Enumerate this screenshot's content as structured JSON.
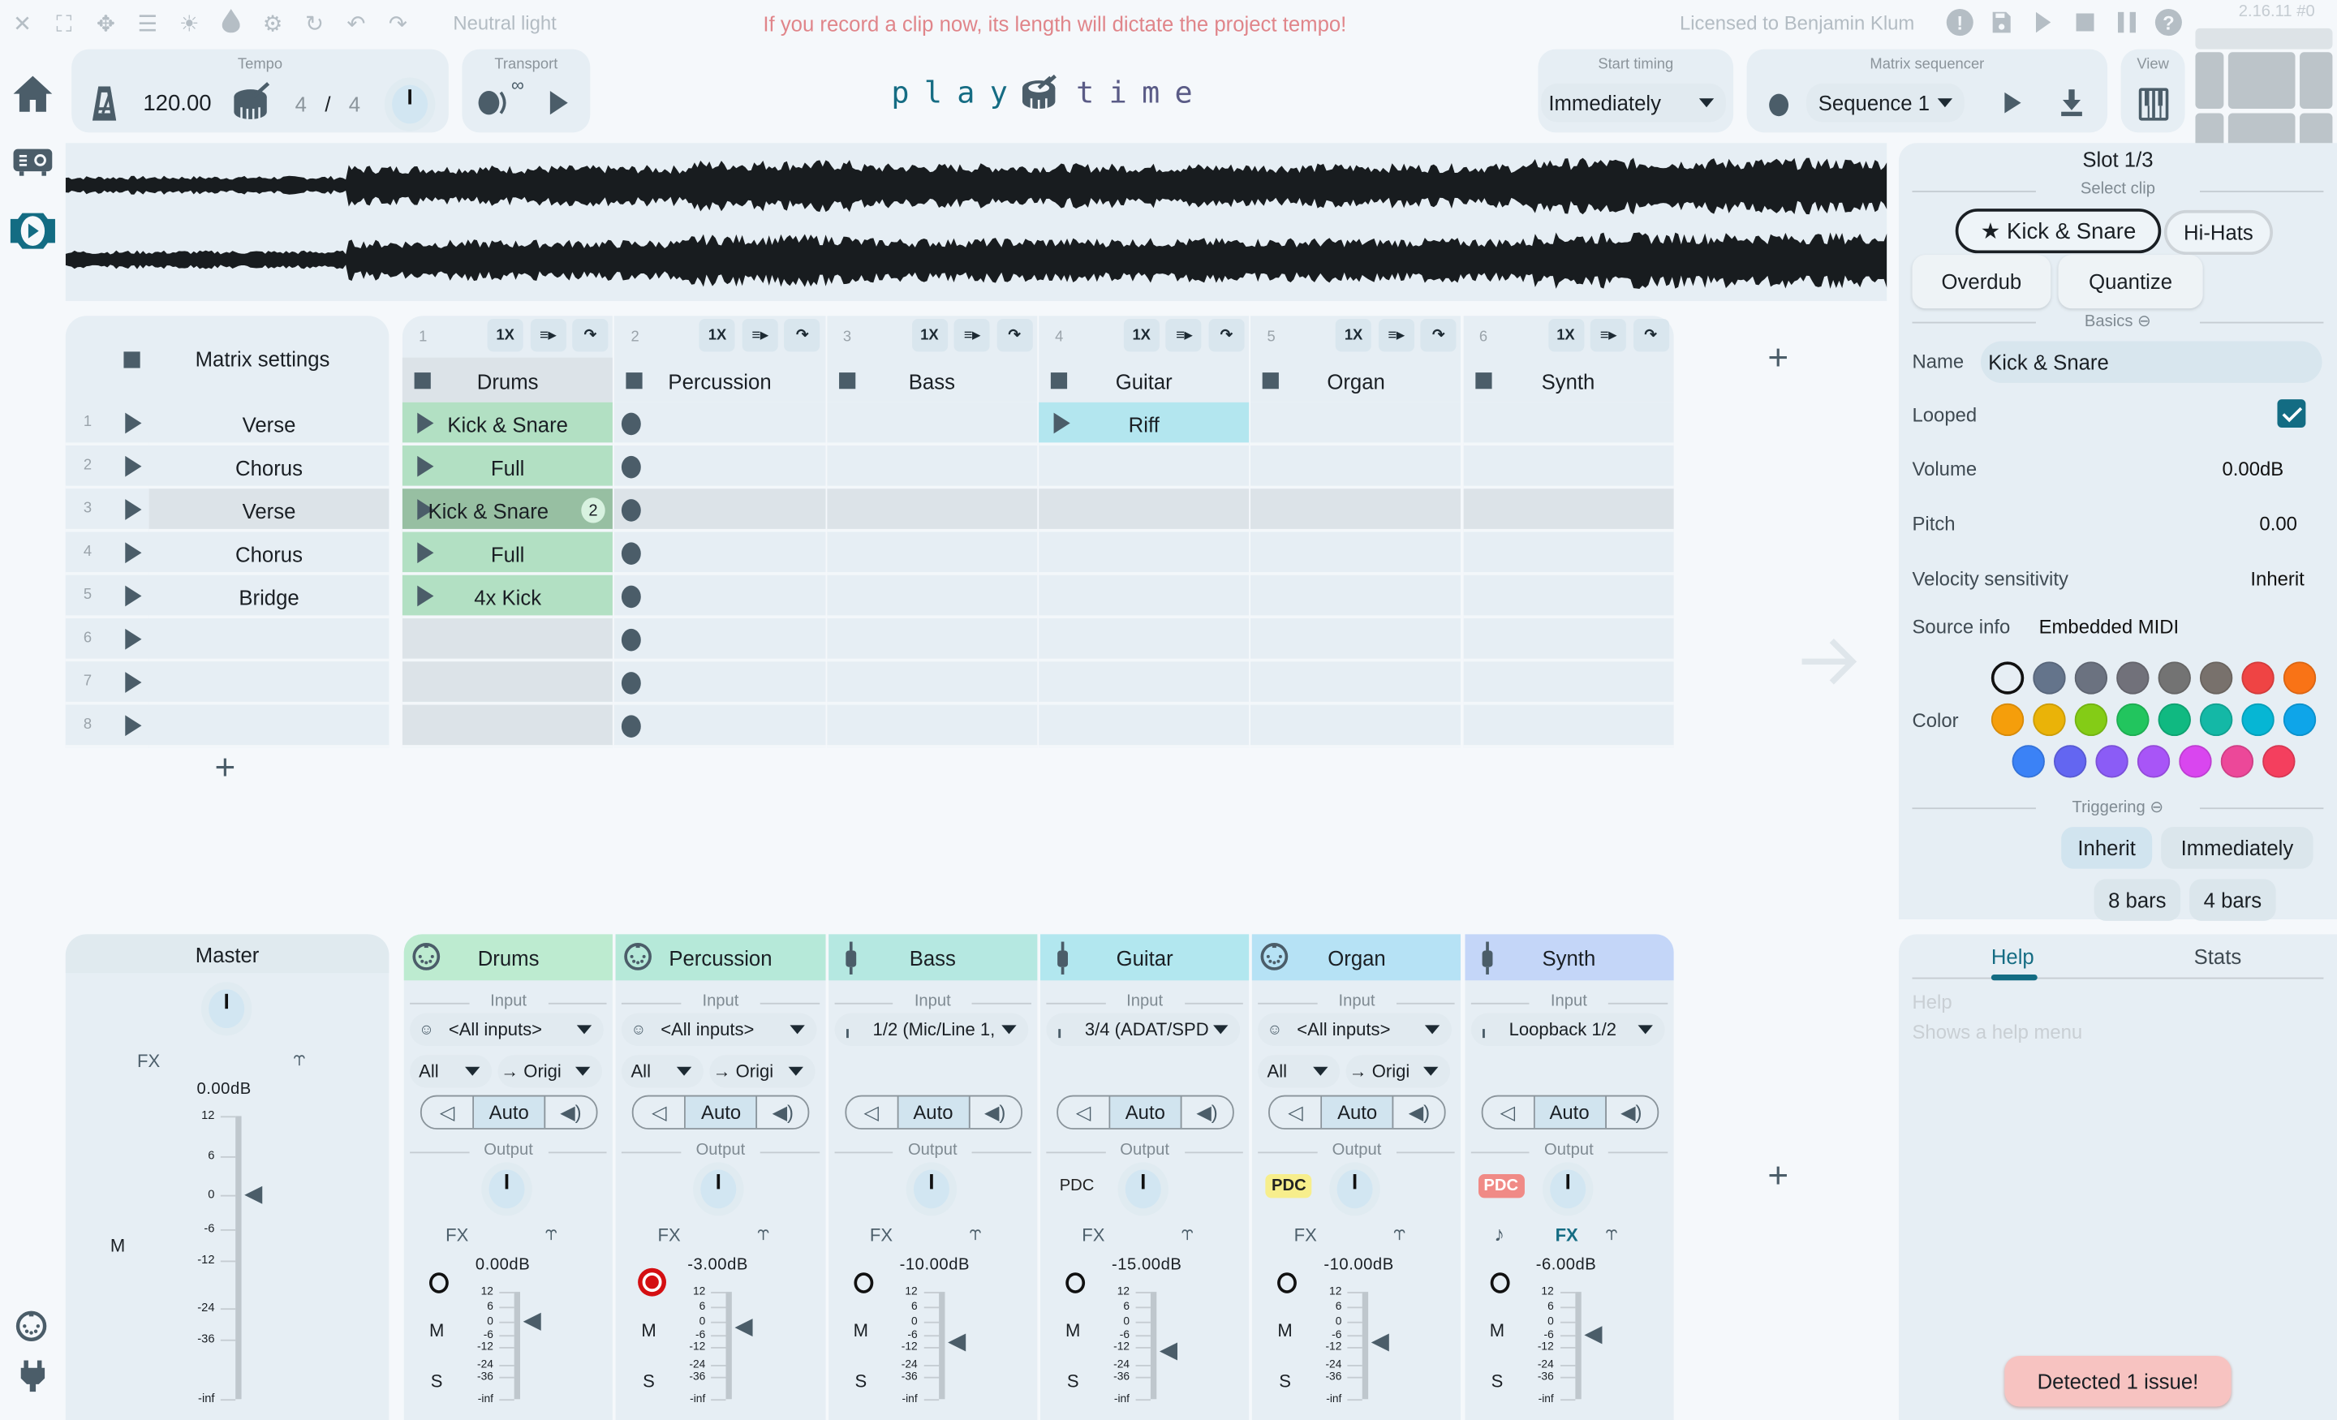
{
  "topbar": {
    "icons": [
      "close-icon",
      "fullscreen-icon",
      "move-icon",
      "menu-collapse-icon",
      "brightness-icon",
      "drop-icon",
      "gear-icon",
      "refresh-icon",
      "undo-icon",
      "redo-icon"
    ],
    "theme": "Neutral light",
    "warning": "If you record a clip now, its length will dictate the project tempo!",
    "license": "Licensed to Benjamin Klum",
    "right_icons": [
      "alert-icon",
      "save-icon",
      "play-icon",
      "stop-icon",
      "pause-icon",
      "help-icon"
    ],
    "version": "2.16.11 #0"
  },
  "tempo": {
    "label": "Tempo",
    "bpm": "120.00",
    "sig_num": "4",
    "sig_sep": "/",
    "sig_den": "4"
  },
  "transport": {
    "label": "Transport",
    "loop_glyph": "∞"
  },
  "logo": {
    "left": "play",
    "right": "time"
  },
  "start_timing": {
    "label": "Start timing",
    "value": "Immediately"
  },
  "sequencer": {
    "label": "Matrix sequencer",
    "value": "Sequence 1"
  },
  "view": {
    "label": "View"
  },
  "matrix": {
    "settings_label": "Matrix settings",
    "mini_buttons": [
      "1X",
      "≡▸",
      "↷"
    ],
    "rows": [
      {
        "num": "1",
        "name": "Verse"
      },
      {
        "num": "2",
        "name": "Chorus"
      },
      {
        "num": "3",
        "name": "Verse"
      },
      {
        "num": "4",
        "name": "Chorus"
      },
      {
        "num": "5",
        "name": "Bridge"
      },
      {
        "num": "6",
        "name": ""
      },
      {
        "num": "7",
        "name": ""
      },
      {
        "num": "8",
        "name": ""
      }
    ],
    "columns": [
      {
        "num": "1",
        "name": "Drums"
      },
      {
        "num": "2",
        "name": "Percussion"
      },
      {
        "num": "3",
        "name": "Bass"
      },
      {
        "num": "4",
        "name": "Guitar"
      },
      {
        "num": "5",
        "name": "Organ"
      },
      {
        "num": "6",
        "name": "Synth"
      }
    ],
    "clips": [
      {
        "col": 0,
        "row": 0,
        "name": "Kick & Snare",
        "badge": ""
      },
      {
        "col": 0,
        "row": 1,
        "name": "Full",
        "badge": ""
      },
      {
        "col": 0,
        "row": 2,
        "name": "Kick & Snare",
        "badge": "2"
      },
      {
        "col": 0,
        "row": 3,
        "name": "Full",
        "badge": ""
      },
      {
        "col": 0,
        "row": 4,
        "name": "4x Kick",
        "badge": ""
      },
      {
        "col": 3,
        "row": 0,
        "name": "Riff",
        "badge": ""
      }
    ],
    "add_row": "+",
    "add_column": "+"
  },
  "inspector": {
    "title": "Slot 1/3",
    "select_clip_label": "Select clip",
    "clips": [
      "★ Kick & Snare",
      "Hi-Hats"
    ],
    "actions": [
      "Overdub",
      "Quantize"
    ],
    "basics_label": "Basics ⊖",
    "name_label": "Name",
    "name_value": "Kick & Snare",
    "looped_label": "Looped",
    "looped": true,
    "volume_label": "Volume",
    "volume_value": "0.00dB",
    "pitch_label": "Pitch",
    "pitch_value": "0.00",
    "velocity_label": "Velocity sensitivity",
    "velocity_value": "Inherit",
    "source_label": "Source info",
    "source_value": "Embedded MIDI",
    "color_label": "Color",
    "colors": [
      "none",
      "#64748b",
      "#6b7280",
      "#71717a",
      "#737373",
      "#78716c",
      "#ef4444",
      "#f97316",
      "#f59e0b",
      "#eab308",
      "#84cc16",
      "#22c55e",
      "#10b981",
      "#14b8a6",
      "#06b6d4",
      "#0ea5e9",
      "#3b82f6",
      "#6366f1",
      "#8b5cf6",
      "#a855f7",
      "#d946ef",
      "#ec4899",
      "#f43f5e"
    ],
    "triggering_label": "Triggering ⊖",
    "trigger_options": [
      "Inherit",
      "Immediately",
      "8 bars",
      "4 bars"
    ],
    "trigger_selected": "Inherit"
  },
  "help": {
    "tabs": [
      "Help",
      "Stats"
    ],
    "active_tab": "Help",
    "title": "Help",
    "text": "Shows a help menu",
    "issue": "Detected 1 issue!"
  },
  "mixer": {
    "master": {
      "name": "Master",
      "fx": "FX",
      "volume": "0.00dB",
      "volume_db": 0,
      "m": "M"
    },
    "scale": [
      "12",
      "6",
      "0",
      "-6",
      "-12",
      "-24",
      "-36",
      "-inf"
    ],
    "input_label": "Input",
    "output_label": "Output",
    "auto_label": "Auto",
    "add_track": "+",
    "strips": [
      {
        "name": "Drums",
        "color": "#bdebd0",
        "input_icon": "midi-icon",
        "input": "<All inputs>",
        "channel": "All",
        "dest": "→ Origi",
        "pdc": "",
        "fx": "FX",
        "volume": "0.00dB",
        "volume_db": 0,
        "armed": false
      },
      {
        "name": "Percussion",
        "color": "#b6e9d9",
        "input_icon": "midi-icon",
        "input": "<All inputs>",
        "channel": "All",
        "dest": "→ Origi",
        "pdc": "",
        "fx": "FX",
        "volume": "-3.00dB",
        "volume_db": -3,
        "armed": true
      },
      {
        "name": "Bass",
        "color": "#b5e8e1",
        "input_icon": "audio-jack-icon",
        "input": "1/2 (Mic/Line 1,",
        "channel": "",
        "dest": "",
        "pdc": "",
        "fx": "FX",
        "volume": "-10.00dB",
        "volume_db": -10,
        "armed": false
      },
      {
        "name": "Guitar",
        "color": "#b2e7ef",
        "input_icon": "audio-jack-icon",
        "input": "3/4 (ADAT/SPD",
        "channel": "",
        "dest": "",
        "pdc": "PDC",
        "pdc_style": "plain",
        "fx": "FX",
        "volume": "-15.00dB",
        "volume_db": -15,
        "armed": false
      },
      {
        "name": "Organ",
        "color": "#b6e2f5",
        "input_icon": "midi-icon",
        "input": "<All inputs>",
        "channel": "All",
        "dest": "→ Origi",
        "pdc": "PDC",
        "pdc_style": "yellow",
        "fx": "FX",
        "volume": "-10.00dB",
        "volume_db": -10,
        "armed": false
      },
      {
        "name": "Synth",
        "color": "#c4d6f8",
        "input_icon": "audio-jack-icon",
        "input": "Loopback 1/2",
        "channel": "",
        "dest": "",
        "pdc": "PDC",
        "pdc_style": "red",
        "fx": "FX",
        "fx_active": true,
        "volume": "-6.00dB",
        "volume_db": -6,
        "armed": false
      }
    ]
  }
}
